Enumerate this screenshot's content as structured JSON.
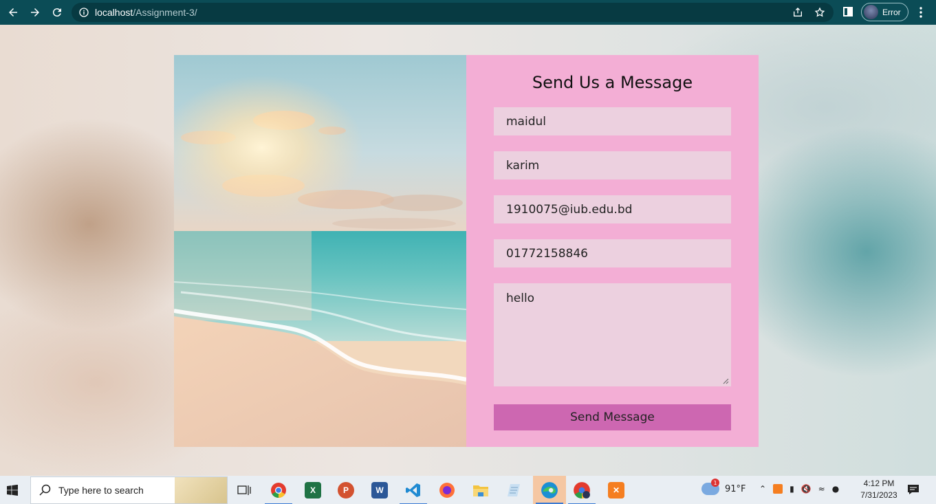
{
  "browser": {
    "url_host": "localhost",
    "url_path": "/Assignment-3/",
    "profile_label": "Error"
  },
  "form": {
    "title": "Send Us a Message",
    "first_name_value": "maidul",
    "last_name_value": "karim",
    "email_value": "1910075@iub.edu.bd",
    "phone_value": "01772158846",
    "message_value": "hello",
    "submit_label": "Send Message"
  },
  "taskbar": {
    "search_placeholder": "Type here to search",
    "apps": [
      "task-view",
      "chrome",
      "excel",
      "powerpoint",
      "word",
      "vscode",
      "firefox",
      "file-explorer",
      "notepad",
      "edge",
      "chrome-profile",
      "xampp"
    ],
    "weather_temp": "91°F",
    "weather_badge": "1",
    "time": "4:12 PM",
    "date": "7/31/2023"
  },
  "colors": {
    "chrome_bg": "#0b4c56",
    "form_bg": "#f3aed5",
    "field_bg": "#ecd0df",
    "button_bg": "#cd67b1"
  }
}
